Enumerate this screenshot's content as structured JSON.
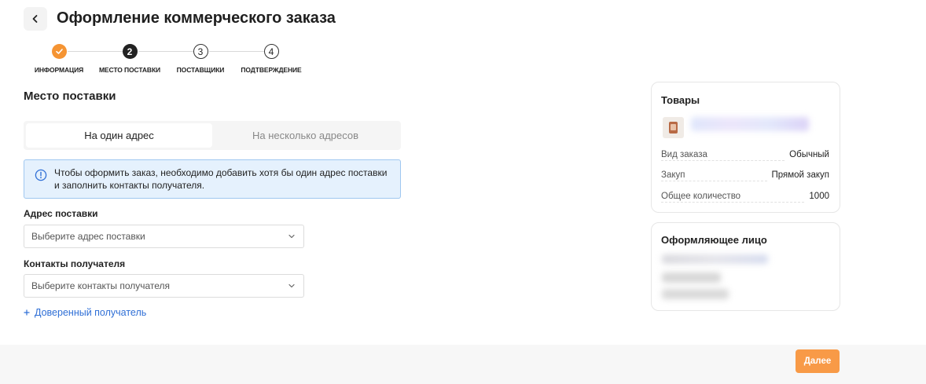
{
  "header": {
    "title": "Оформление коммерческого заказа"
  },
  "stepper": {
    "steps": [
      {
        "number": "",
        "label": "ИНФОРМАЦИЯ",
        "state": "done"
      },
      {
        "number": "2",
        "label": "МЕСТО ПОСТАВКИ",
        "state": "active"
      },
      {
        "number": "3",
        "label": "ПОСТАВЩИКИ",
        "state": "todo"
      },
      {
        "number": "4",
        "label": "ПОДТВЕРЖДЕНИЕ",
        "state": "todo"
      }
    ]
  },
  "delivery": {
    "section_title": "Место поставки",
    "tabs": [
      {
        "label": "На один адрес",
        "active": true
      },
      {
        "label": "На несколько адресов",
        "active": false
      }
    ],
    "notice": "Чтобы оформить заказ, необходимо добавить хотя бы один адрес поставки и заполнить контакты получателя.",
    "address_label": "Адрес поставки",
    "address_placeholder": "Выберите адрес поставки",
    "contacts_label": "Контакты получателя",
    "contacts_placeholder": "Выберите контакты получателя",
    "trusted_recipient": "Доверенный получатель"
  },
  "goods_card": {
    "title": "Товары",
    "rows": [
      {
        "key": "Вид заказа",
        "value": "Обычный"
      },
      {
        "key": "Закуп",
        "value": "Прямой закуп"
      },
      {
        "key": "Общее количество",
        "value": "1000"
      }
    ]
  },
  "person_card": {
    "title": "Оформляющее лицо"
  },
  "footer": {
    "next_label": "Далее"
  },
  "colors": {
    "accent_orange": "#f59433",
    "button_orange": "#f89a47",
    "notice_bg": "#e5f1fd",
    "notice_border": "#9fc7f0",
    "link_blue": "#2f6fd6"
  }
}
